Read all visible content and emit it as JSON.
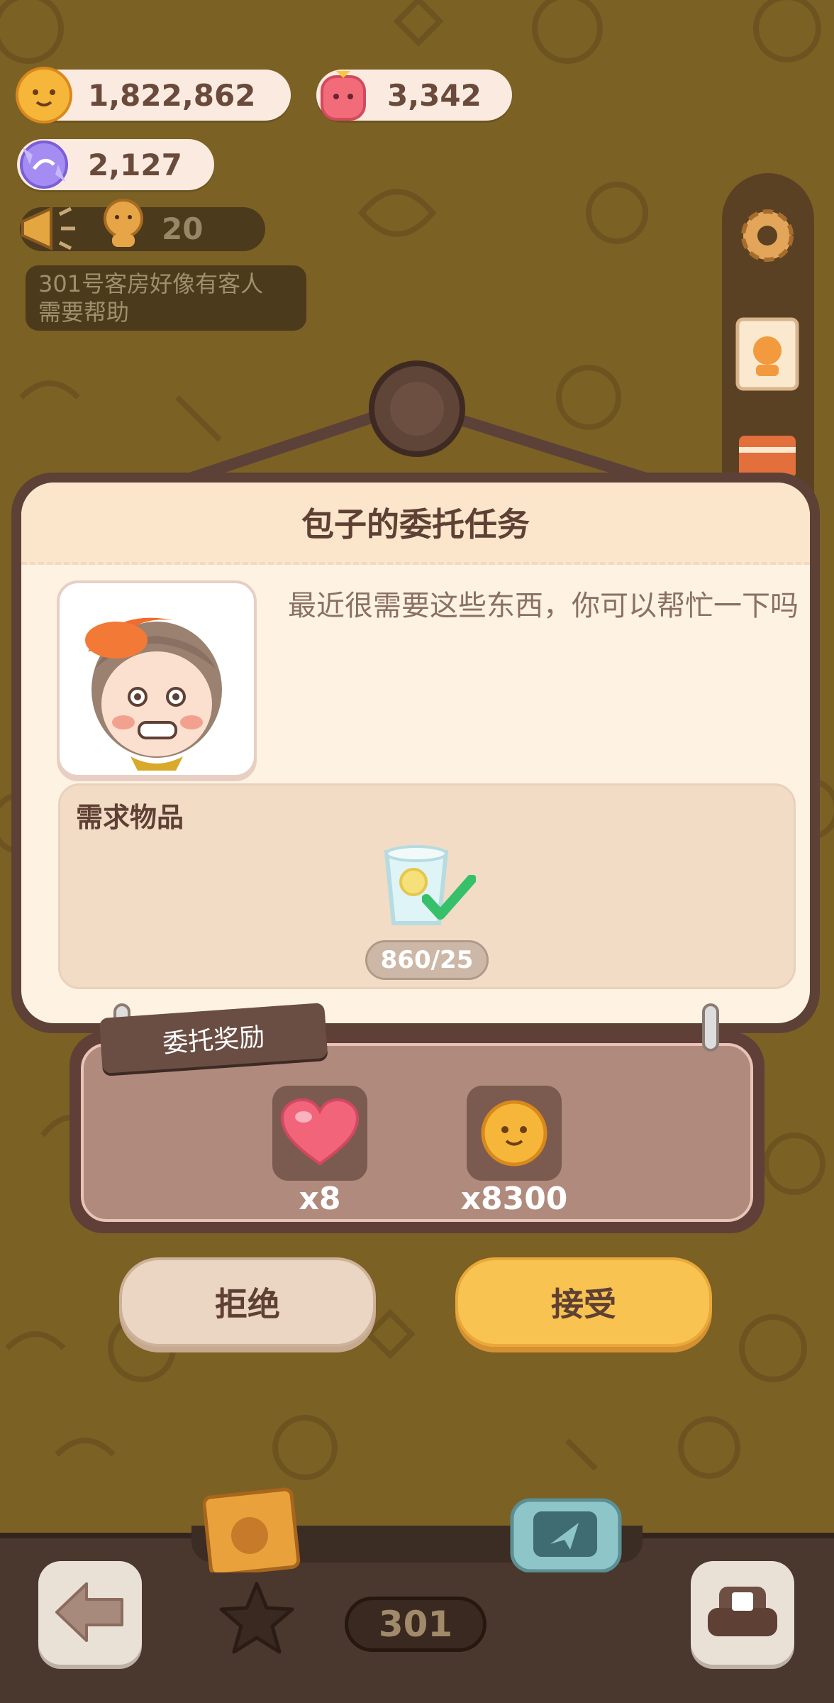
{
  "currencies": {
    "cookies": "1,822,862",
    "gems": "3,342",
    "candy": "2,127"
  },
  "ticker": {
    "count": "20"
  },
  "notice": {
    "line1": "301号客房好像有客人",
    "line2": "需要帮助"
  },
  "dialog": {
    "title": "包子的委托任务",
    "message": "最近很需要这些东西，你可以帮忙一下吗",
    "required_label": "需求物品",
    "required_count": "860/25"
  },
  "reward": {
    "tag_label": "委托奖励",
    "items": [
      {
        "icon": "heart-icon",
        "amount": "x8"
      },
      {
        "icon": "cookie-icon",
        "amount": "x8300"
      }
    ]
  },
  "buttons": {
    "reject": "拒绝",
    "accept": "接受"
  },
  "bottom": {
    "room_number": "301"
  },
  "colors": {
    "accent": "#f8c351",
    "panel": "#5d4137",
    "background": "#7c6124"
  }
}
